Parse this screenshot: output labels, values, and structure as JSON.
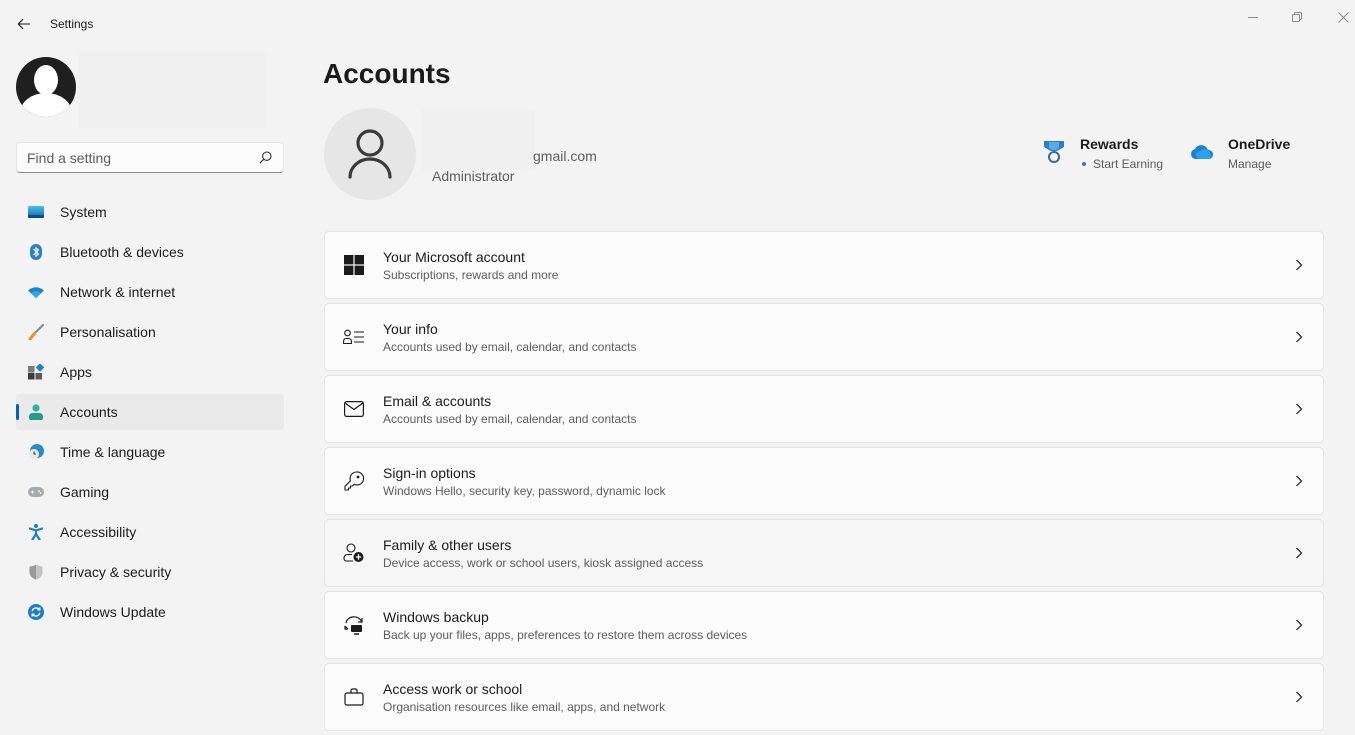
{
  "window": {
    "title": "Settings",
    "controls": [
      "minimize",
      "maximize",
      "close"
    ]
  },
  "sidebar": {
    "search": {
      "placeholder": "Find a setting",
      "value": ""
    },
    "items": [
      {
        "label": "System",
        "icon": "monitor-icon",
        "color": "#1a9bd7"
      },
      {
        "label": "Bluetooth & devices",
        "icon": "bluetooth-icon",
        "color": "#2b7fcf"
      },
      {
        "label": "Network & internet",
        "icon": "wifi-icon",
        "color": "#1a80d0"
      },
      {
        "label": "Personalisation",
        "icon": "brush-icon",
        "color": "#e8912e"
      },
      {
        "label": "Apps",
        "icon": "apps-icon",
        "color": "#444444"
      },
      {
        "label": "Accounts",
        "icon": "person-icon",
        "color": "#2fb3a0",
        "active": true
      },
      {
        "label": "Time & language",
        "icon": "globe-clock-icon",
        "color": "#2a8cc9"
      },
      {
        "label": "Gaming",
        "icon": "gamepad-icon",
        "color": "#9aa0a6"
      },
      {
        "label": "Accessibility",
        "icon": "accessibility-icon",
        "color": "#1a7fc8"
      },
      {
        "label": "Privacy & security",
        "icon": "shield-icon",
        "color": "#8a8a8a"
      },
      {
        "label": "Windows Update",
        "icon": "update-icon",
        "color": "#1a7fc8"
      }
    ]
  },
  "main": {
    "title": "Accounts",
    "user": {
      "email": "gmail.com",
      "role": "Administrator"
    },
    "quick_links": {
      "rewards": {
        "title": "Rewards",
        "subtitle": "Start Earning"
      },
      "onedrive": {
        "title": "OneDrive",
        "subtitle": "Manage"
      }
    },
    "cards": [
      {
        "title": "Your Microsoft account",
        "subtitle": "Subscriptions, rewards and more",
        "icon": "windows-logo-icon"
      },
      {
        "title": "Your info",
        "subtitle": "Accounts used by email, calendar, and contacts",
        "icon": "person-card-icon"
      },
      {
        "title": "Email & accounts",
        "subtitle": "Accounts used by email, calendar, and contacts",
        "icon": "mail-icon"
      },
      {
        "title": "Sign-in options",
        "subtitle": "Windows Hello, security key, password, dynamic lock",
        "icon": "key-icon"
      },
      {
        "title": "Family & other users",
        "subtitle": "Device access, work or school users, kiosk assigned access",
        "icon": "person-add-icon",
        "hover": true
      },
      {
        "title": "Windows backup",
        "subtitle": "Back up your files, apps, preferences to restore them across devices",
        "icon": "backup-icon"
      },
      {
        "title": "Access work or school",
        "subtitle": "Organisation resources like email, apps, and network",
        "icon": "briefcase-icon"
      }
    ]
  },
  "colors": {
    "accent": "#005fb8",
    "background": "#f3f3f3",
    "card": "#fbfbfb"
  }
}
